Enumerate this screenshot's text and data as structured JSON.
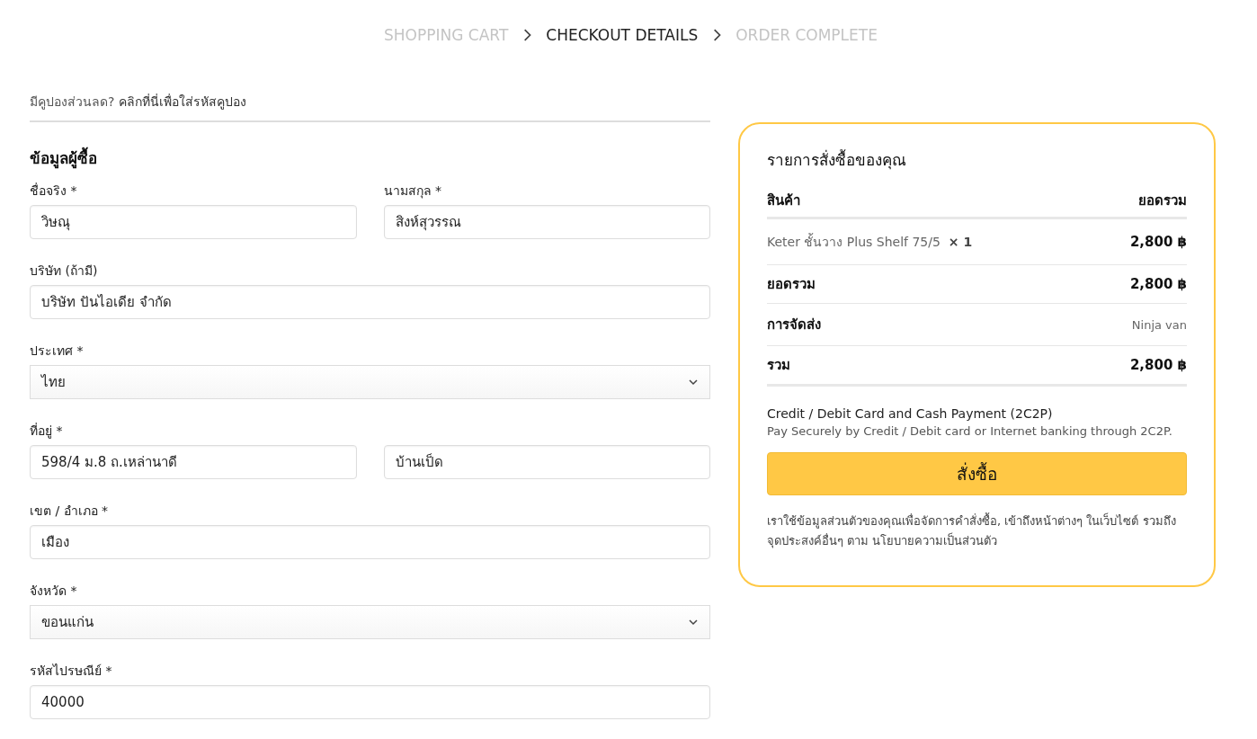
{
  "steps": [
    {
      "label": "SHOPPING CART",
      "selected": false
    },
    {
      "label": "CHECKOUT DETAILS",
      "selected": true
    },
    {
      "label": "ORDER COMPLETE",
      "selected": false
    }
  ],
  "coupon": {
    "text": "มีคูปองส่วนลด?",
    "link": "คลิกที่นี่เพื่อใส่รหัสคูปอง"
  },
  "billing": {
    "title": "ข้อมูลผู้ซื้อ",
    "rows": [
      {
        "fields": [
          {
            "label": "ชื่อจริง *",
            "kind": "text",
            "value": "วิษณุ"
          },
          {
            "label": "นามสกุล *",
            "kind": "text",
            "value": "สิงห์สุวรรณ"
          }
        ]
      },
      {
        "fields": [
          {
            "label": "บริษัท (ถ้ามี)",
            "kind": "text",
            "value": "บริษัท ปันไอเดีย จำกัด"
          }
        ]
      },
      {
        "fields": [
          {
            "label": "ประเทศ *",
            "kind": "select",
            "value": "ไทย"
          }
        ]
      },
      {
        "fields": [
          {
            "label": "ที่อยู่ *",
            "kind": "text",
            "value": "598/4 ม.8 ถ.เหล่านาดี"
          },
          {
            "kind": "text",
            "value": "บ้านเป็ด"
          }
        ]
      },
      {
        "fields": [
          {
            "label": "เขต / อำเภอ *",
            "kind": "text",
            "value": "เมือง"
          }
        ]
      },
      {
        "fields": [
          {
            "label": "จังหวัด *",
            "kind": "select",
            "value": "ขอนแก่น"
          }
        ]
      },
      {
        "fields": [
          {
            "label": "รหัสไปรษณีย์ *",
            "kind": "text",
            "value": "40000"
          }
        ]
      }
    ]
  },
  "order": {
    "title": "รายการสั่งซื้อของคุณ",
    "columns": [
      "สินค้า",
      "ยอดรวม"
    ],
    "items": [
      {
        "name": "Keter ชั้นวาง Plus Shelf 75/5",
        "qty": "× 1",
        "total": "2,800 ฿"
      }
    ],
    "subtotal": {
      "label": "ยอดรวม",
      "value": "2,800 ฿"
    },
    "shipping": {
      "label": "การจัดส่ง",
      "value": "Ninja van"
    },
    "total": {
      "label": "รวม",
      "value": "2,800 ฿"
    },
    "payment": {
      "name": "Credit / Debit Card and Cash Payment (2C2P)",
      "description": "Pay Securely by Credit / Debit card or Internet banking through 2C2P."
    },
    "button": "สั่งซื้อ",
    "privacy": {
      "text": "เราใช้ข้อมูลส่วนตัวของคุณเพื่อจัดการคำสั่งซื้อ, เข้าถึงหน้าต่างๆ ในเว็บไซต์ รวมถึงจุดประสงค์อื่นๆ ตาม",
      "link": "นโยบายความเป็นส่วนตัว"
    }
  }
}
